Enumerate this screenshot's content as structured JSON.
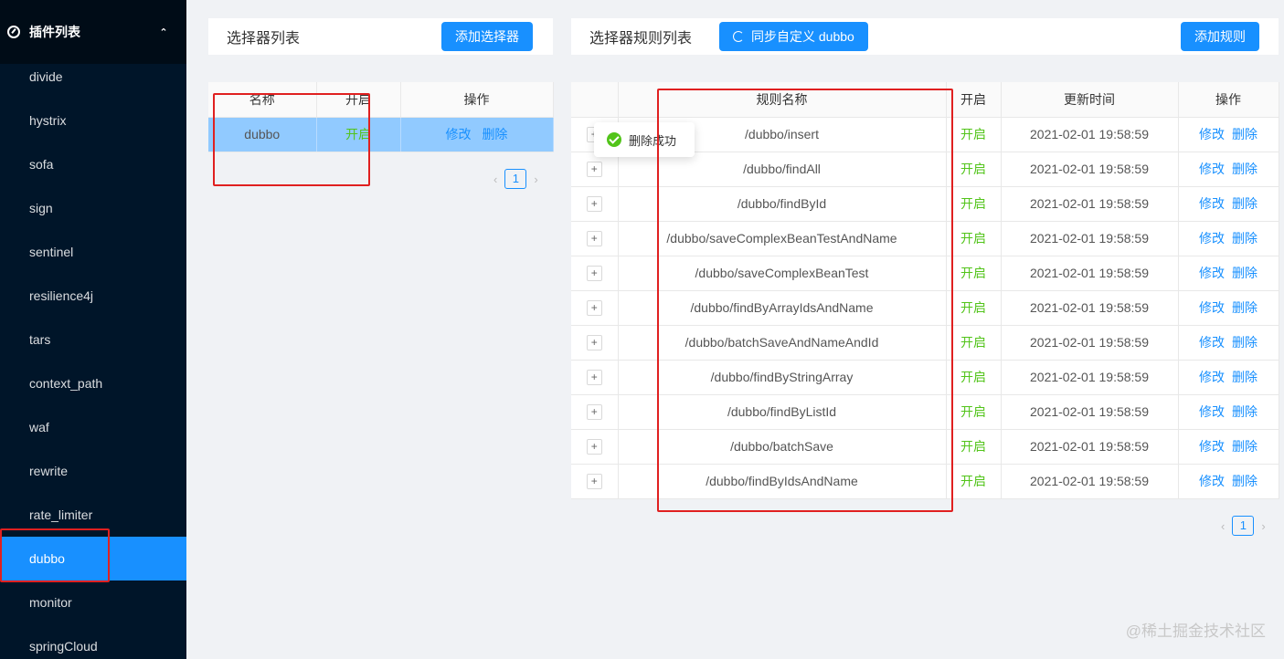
{
  "sidebar": {
    "header": {
      "title": "插件列表",
      "icon": "gauge-icon",
      "chevron": "chevron-up-icon"
    },
    "items": [
      {
        "label": "divide"
      },
      {
        "label": "hystrix"
      },
      {
        "label": "sofa"
      },
      {
        "label": "sign"
      },
      {
        "label": "sentinel"
      },
      {
        "label": "resilience4j"
      },
      {
        "label": "tars"
      },
      {
        "label": "context_path"
      },
      {
        "label": "waf"
      },
      {
        "label": "rewrite"
      },
      {
        "label": "rate_limiter"
      },
      {
        "label": "dubbo"
      },
      {
        "label": "monitor"
      },
      {
        "label": "springCloud"
      }
    ],
    "active": "dubbo"
  },
  "selector_panel": {
    "title": "选择器列表",
    "add_button": "添加选择器",
    "columns": [
      "名称",
      "开启",
      "操作"
    ],
    "rows": [
      {
        "name": "dubbo",
        "status": "开启",
        "edit": "修改",
        "delete": "删除"
      }
    ],
    "page": "1"
  },
  "rule_panel": {
    "title": "选择器规则列表",
    "sync_button": "同步自定义 dubbo",
    "add_button": "添加规则",
    "columns": [
      "",
      "规则名称",
      "开启",
      "更新时间",
      "操作"
    ],
    "rows": [
      {
        "name": "/dubbo/insert",
        "status": "开启",
        "time": "2021-02-01 19:58:59",
        "edit": "修改",
        "delete": "删除"
      },
      {
        "name": "/dubbo/findAll",
        "status": "开启",
        "time": "2021-02-01 19:58:59",
        "edit": "修改",
        "delete": "删除"
      },
      {
        "name": "/dubbo/findById",
        "status": "开启",
        "time": "2021-02-01 19:58:59",
        "edit": "修改",
        "delete": "删除"
      },
      {
        "name": "/dubbo/saveComplexBeanTestAndName",
        "status": "开启",
        "time": "2021-02-01 19:58:59",
        "edit": "修改",
        "delete": "删除"
      },
      {
        "name": "/dubbo/saveComplexBeanTest",
        "status": "开启",
        "time": "2021-02-01 19:58:59",
        "edit": "修改",
        "delete": "删除"
      },
      {
        "name": "/dubbo/findByArrayIdsAndName",
        "status": "开启",
        "time": "2021-02-01 19:58:59",
        "edit": "修改",
        "delete": "删除"
      },
      {
        "name": "/dubbo/batchSaveAndNameAndId",
        "status": "开启",
        "time": "2021-02-01 19:58:59",
        "edit": "修改",
        "delete": "删除"
      },
      {
        "name": "/dubbo/findByStringArray",
        "status": "开启",
        "time": "2021-02-01 19:58:59",
        "edit": "修改",
        "delete": "删除"
      },
      {
        "name": "/dubbo/findByListId",
        "status": "开启",
        "time": "2021-02-01 19:58:59",
        "edit": "修改",
        "delete": "删除"
      },
      {
        "name": "/dubbo/batchSave",
        "status": "开启",
        "time": "2021-02-01 19:58:59",
        "edit": "修改",
        "delete": "删除"
      },
      {
        "name": "/dubbo/findByIdsAndName",
        "status": "开启",
        "time": "2021-02-01 19:58:59",
        "edit": "修改",
        "delete": "删除"
      }
    ],
    "page": "1"
  },
  "toast": {
    "message": "删除成功",
    "icon": "check-circle-icon"
  },
  "watermark": "@稀土掘金技术社区",
  "colors": {
    "sidebar": "#001529",
    "accent": "#1890ff",
    "enabled": "#52c41a",
    "highlight": "#e02020"
  }
}
